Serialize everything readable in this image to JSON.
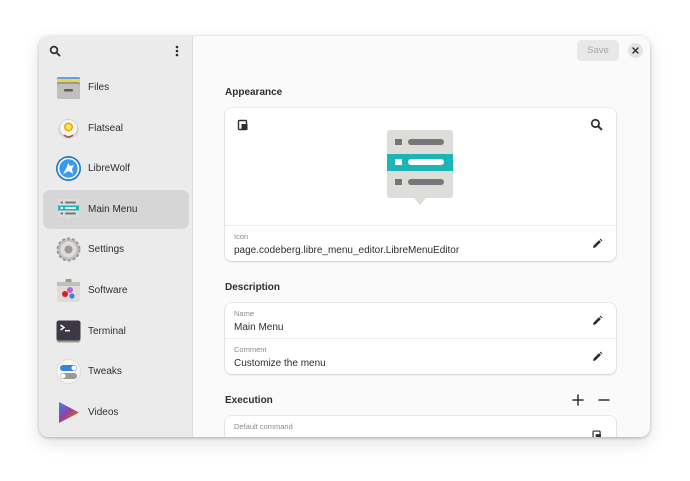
{
  "save_label": "Save",
  "apps": [
    {
      "name": "Files",
      "icon": "files-icon"
    },
    {
      "name": "Flatseal",
      "icon": "flatseal-icon"
    },
    {
      "name": "LibreWolf",
      "icon": "librewolf-icon"
    },
    {
      "name": "Main Menu",
      "icon": "main-menu-icon",
      "selected": true
    },
    {
      "name": "Settings",
      "icon": "settings-icon"
    },
    {
      "name": "Software",
      "icon": "software-icon"
    },
    {
      "name": "Terminal",
      "icon": "terminal-icon"
    },
    {
      "name": "Tweaks",
      "icon": "tweaks-icon"
    },
    {
      "name": "Videos",
      "icon": "videos-icon"
    }
  ],
  "appearance": {
    "title": "Appearance",
    "icon_label": "Icon",
    "icon_value": "page.codeberg.libre_menu_editor.LibreMenuEditor"
  },
  "description": {
    "title": "Description",
    "name_label": "Name",
    "name_value": "Main Menu",
    "comment_label": "Comment",
    "comment_value": "Customize the menu"
  },
  "execution": {
    "title": "Execution",
    "default_command_label": "Default command"
  },
  "colors": {
    "accent": "#1cb5b5",
    "sidebar": "#ebebeb",
    "selected": "#d6d6d6"
  }
}
